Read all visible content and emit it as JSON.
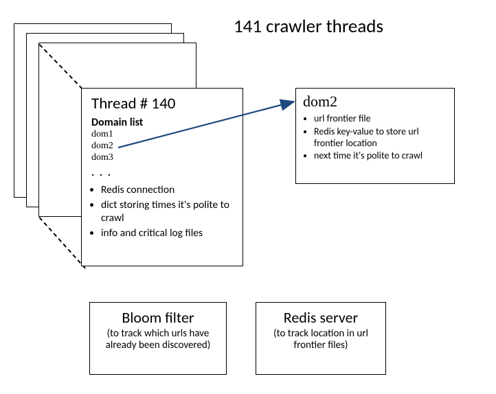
{
  "title": "141 crawler threads",
  "thread": {
    "title": "Thread # 140",
    "domain_list_label": "Domain list",
    "domains": {
      "d0": "dom1",
      "d1": "dom2",
      "d2": "dom3"
    },
    "ellipsis": ". . .",
    "bullets": {
      "b0": "Redis connection",
      "b1": "dict storing times it's polite to crawl",
      "b2": "info and critical log files"
    }
  },
  "dom2": {
    "title": "dom2",
    "bullets": {
      "b0": "url frontier file",
      "b1": "Redis key-value to store url frontier location",
      "b2": "next time it's polite to crawl"
    }
  },
  "bloom": {
    "title": "Bloom filter",
    "sub": "(to track which urls have already been discovered)"
  },
  "redis": {
    "title": "Redis server",
    "sub": "(to track location in url frontier files)"
  }
}
